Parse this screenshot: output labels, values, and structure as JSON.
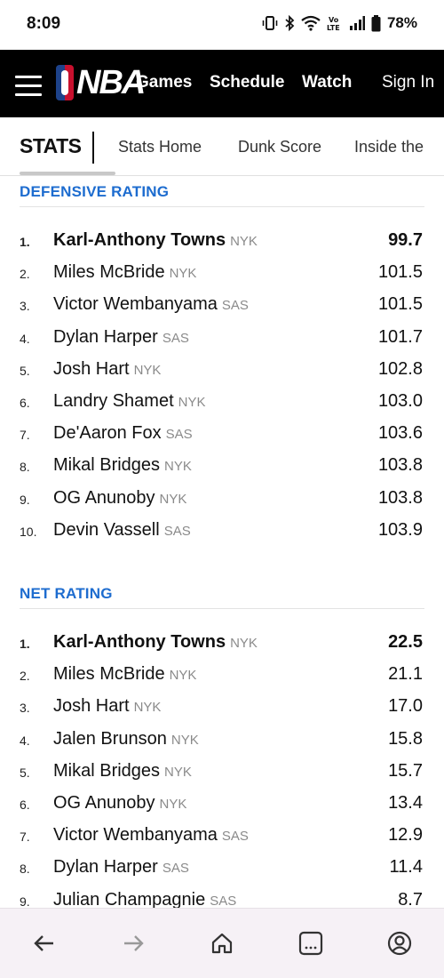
{
  "status_bar": {
    "time": "8:09",
    "battery_percent": "78%",
    "network": "LTE",
    "icons": [
      "vibrate-icon",
      "bluetooth-icon",
      "wifi-icon",
      "volte-icon",
      "signal-icon",
      "battery-icon"
    ]
  },
  "header": {
    "logo_text": "NBA",
    "nav": {
      "games": "Games",
      "schedule": "Schedule",
      "watch": "Watch",
      "signin": "Sign In"
    }
  },
  "stats_nav": {
    "title": "STATS",
    "links": {
      "stats_home": "Stats Home",
      "dunk_score": "Dunk Score",
      "inside_the": "Inside the"
    }
  },
  "defensive_rating": {
    "title": "DEFENSIVE RATING",
    "rows": [
      {
        "rank": "1.",
        "name": "Karl-Anthony Towns",
        "team": "NYK",
        "value": "99.7"
      },
      {
        "rank": "2.",
        "name": "Miles McBride",
        "team": "NYK",
        "value": "101.5"
      },
      {
        "rank": "3.",
        "name": "Victor Wembanyama",
        "team": "SAS",
        "value": "101.5"
      },
      {
        "rank": "4.",
        "name": "Dylan Harper",
        "team": "SAS",
        "value": "101.7"
      },
      {
        "rank": "5.",
        "name": "Josh Hart",
        "team": "NYK",
        "value": "102.8"
      },
      {
        "rank": "6.",
        "name": "Landry Shamet",
        "team": "NYK",
        "value": "103.0"
      },
      {
        "rank": "7.",
        "name": "De'Aaron Fox",
        "team": "SAS",
        "value": "103.6"
      },
      {
        "rank": "8.",
        "name": "Mikal Bridges",
        "team": "NYK",
        "value": "103.8"
      },
      {
        "rank": "9.",
        "name": "OG Anunoby",
        "team": "NYK",
        "value": "103.8"
      },
      {
        "rank": "10.",
        "name": "Devin Vassell",
        "team": "SAS",
        "value": "103.9"
      }
    ]
  },
  "net_rating": {
    "title": "NET RATING",
    "rows": [
      {
        "rank": "1.",
        "name": "Karl-Anthony Towns",
        "team": "NYK",
        "value": "22.5"
      },
      {
        "rank": "2.",
        "name": "Miles McBride",
        "team": "NYK",
        "value": "21.1"
      },
      {
        "rank": "3.",
        "name": "Josh Hart",
        "team": "NYK",
        "value": "17.0"
      },
      {
        "rank": "4.",
        "name": "Jalen Brunson",
        "team": "NYK",
        "value": "15.8"
      },
      {
        "rank": "5.",
        "name": "Mikal Bridges",
        "team": "NYK",
        "value": "15.7"
      },
      {
        "rank": "6.",
        "name": "OG Anunoby",
        "team": "NYK",
        "value": "13.4"
      },
      {
        "rank": "7.",
        "name": "Victor Wembanyama",
        "team": "SAS",
        "value": "12.9"
      },
      {
        "rank": "8.",
        "name": "Dylan Harper",
        "team": "SAS",
        "value": "11.4"
      },
      {
        "rank": "9.",
        "name": "Julian Champagnie",
        "team": "SAS",
        "value": "8.7"
      }
    ]
  },
  "bottom_bar": {
    "icons": [
      "back-arrow-icon",
      "forward-arrow-icon",
      "home-icon",
      "tabs-icon",
      "account-icon"
    ]
  },
  "colors": {
    "header_bg": "#000000",
    "section_title": "#1d6ccf",
    "team_abbr": "#8a8a8a",
    "bottom_bar_bg": "#f6f1f6"
  }
}
